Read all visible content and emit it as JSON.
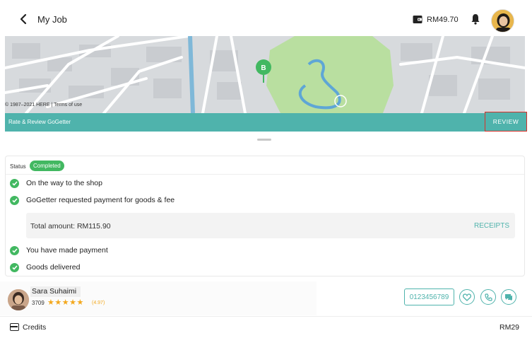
{
  "header": {
    "title": "My Job",
    "balance": "RM49.70",
    "icons": {
      "back": "chevron-left-icon",
      "wallet": "wallet-icon",
      "bell": "bell-icon"
    }
  },
  "map": {
    "credit": "© 1987–2021 HERE | Terms of use",
    "pin_label": "B",
    "colors": {
      "park": "#b9dfa0",
      "water": "#7fb8d8",
      "road": "#ffffff",
      "pin": "#42b861"
    }
  },
  "review_bar": {
    "label": "Rate & Review GoGetter",
    "button": "REVIEW",
    "color": "#4fb3ac"
  },
  "status": {
    "label": "Status",
    "badge": "Completed",
    "badge_color": "#42b861",
    "steps": [
      "On the way to the shop",
      "GoGetter requested payment for goods & fee",
      "You have made payment",
      "Goods delivered"
    ],
    "total": "Total amount: RM115.90",
    "receipts": "RECEIPTS"
  },
  "driver": {
    "name": "Sara Suhaimi",
    "trips": "3709",
    "stars": "★★★★★",
    "rating": "(4.97)",
    "phone": "0123456789",
    "icons": [
      "heart-icon",
      "phone-icon",
      "chat-icon"
    ]
  },
  "footer": {
    "label": "Credits",
    "value": "RM29"
  }
}
